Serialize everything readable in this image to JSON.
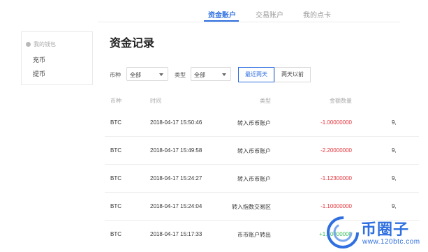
{
  "topnav": {
    "tabs": [
      {
        "label": "资金账户",
        "active": true
      },
      {
        "label": "交易账户",
        "active": false
      },
      {
        "label": "我的点卡",
        "active": false
      }
    ]
  },
  "sidebar": {
    "group_label": "我的钱包",
    "items": [
      {
        "label": "充币"
      },
      {
        "label": "提币"
      }
    ]
  },
  "page_title": "资金记录",
  "filters": {
    "coin_label": "币种",
    "coin_value": "全部",
    "type_label": "类型",
    "type_value": "全部",
    "range_buttons": [
      {
        "label": "最近两天",
        "active": true
      },
      {
        "label": "两天以前",
        "active": false
      }
    ]
  },
  "table": {
    "headers": {
      "coin": "币种",
      "time": "时间",
      "type": "类型",
      "amount": "金额数量"
    },
    "rows": [
      {
        "coin": "BTC",
        "time": "2018-04-17 15:50:46",
        "type": "转入币币账户",
        "amount": "-1.00000000",
        "sign": "neg",
        "balance": "9,"
      },
      {
        "coin": "BTC",
        "time": "2018-04-17 15:49:58",
        "type": "转入币币账户",
        "amount": "-2.20000000",
        "sign": "neg",
        "balance": "9,"
      },
      {
        "coin": "BTC",
        "time": "2018-04-17 15:24:27",
        "type": "转入币币账户",
        "amount": "-1.12300000",
        "sign": "neg",
        "balance": "9,"
      },
      {
        "coin": "BTC",
        "time": "2018-04-17 15:24:04",
        "type": "转入指数交易区",
        "amount": "-1.10000000",
        "sign": "neg",
        "balance": "9,"
      },
      {
        "coin": "BTC",
        "time": "2018-04-17 15:17:33",
        "type": "币币账户转出",
        "amount": "+1.40000000",
        "sign": "pos",
        "balance": ""
      }
    ]
  },
  "watermark": {
    "brand": "币圈子",
    "site": "www.120btc.com"
  },
  "colors": {
    "accent": "#2f6fe0",
    "negative": "#e5333b",
    "positive": "#3bbf5a"
  }
}
